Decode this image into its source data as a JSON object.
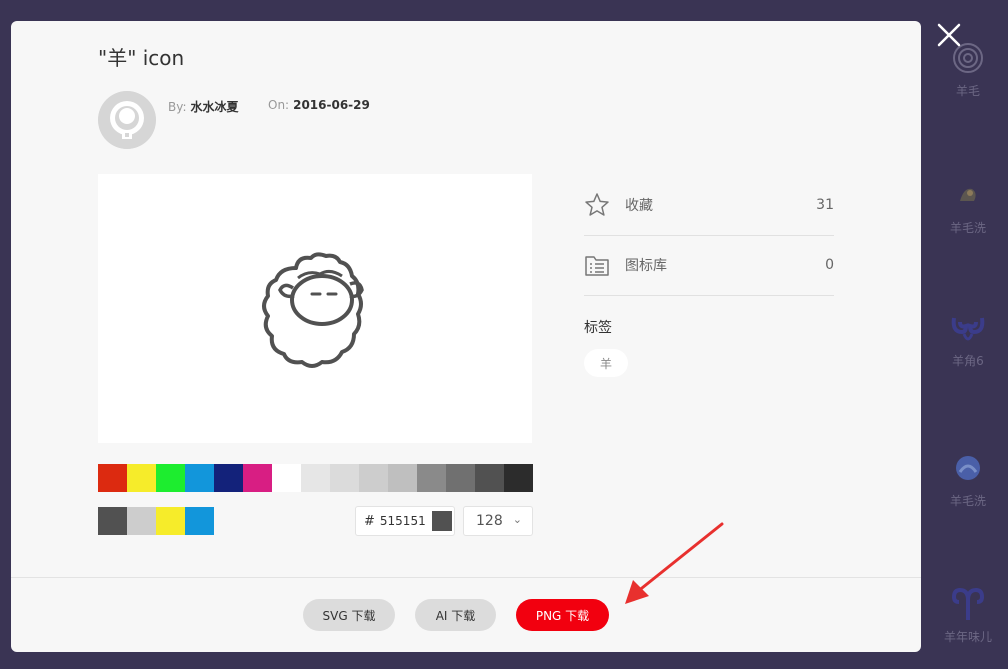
{
  "modal": {
    "title": "\"羊\" icon",
    "author_key": "By:",
    "author": "水水冰夏",
    "date_key": "On:",
    "date": "2016-06-29"
  },
  "stats": [
    {
      "label": "收藏",
      "count": "31",
      "icon": "star-icon"
    },
    {
      "label": "图标库",
      "count": "0",
      "icon": "folder-list-icon"
    }
  ],
  "tags": {
    "heading": "标签",
    "items": [
      "羊"
    ]
  },
  "palette": [
    "#dc2a10",
    "#f6ec2a",
    "#1ded2f",
    "#1296db",
    "#13227a",
    "#d81e83",
    "#ffffff",
    "#e6e6e6",
    "#dbdbdb",
    "#cdcdcd",
    "#bfbfbf",
    "#8a8a8a",
    "#707070",
    "#515151",
    "#2c2c2c"
  ],
  "recent_colors": [
    "#515151",
    "#cdcdcd",
    "#f6ec2a",
    "#1296db"
  ],
  "color_picker": {
    "hash": "#",
    "value": "515151",
    "current_color": "#515151"
  },
  "size_select": {
    "value": "128",
    "chevron": "chevron-down-icon"
  },
  "downloads": {
    "svg": "SVG 下载",
    "ai": "AI 下载",
    "png": "PNG 下载"
  },
  "annotation_arrow_color": "#e8302e",
  "background_list": [
    {
      "label": "羊毛"
    },
    {
      "label": "羊毛洗"
    },
    {
      "label": "羊角6"
    },
    {
      "label": "羊毛洗"
    },
    {
      "label": "羊年味儿"
    }
  ]
}
